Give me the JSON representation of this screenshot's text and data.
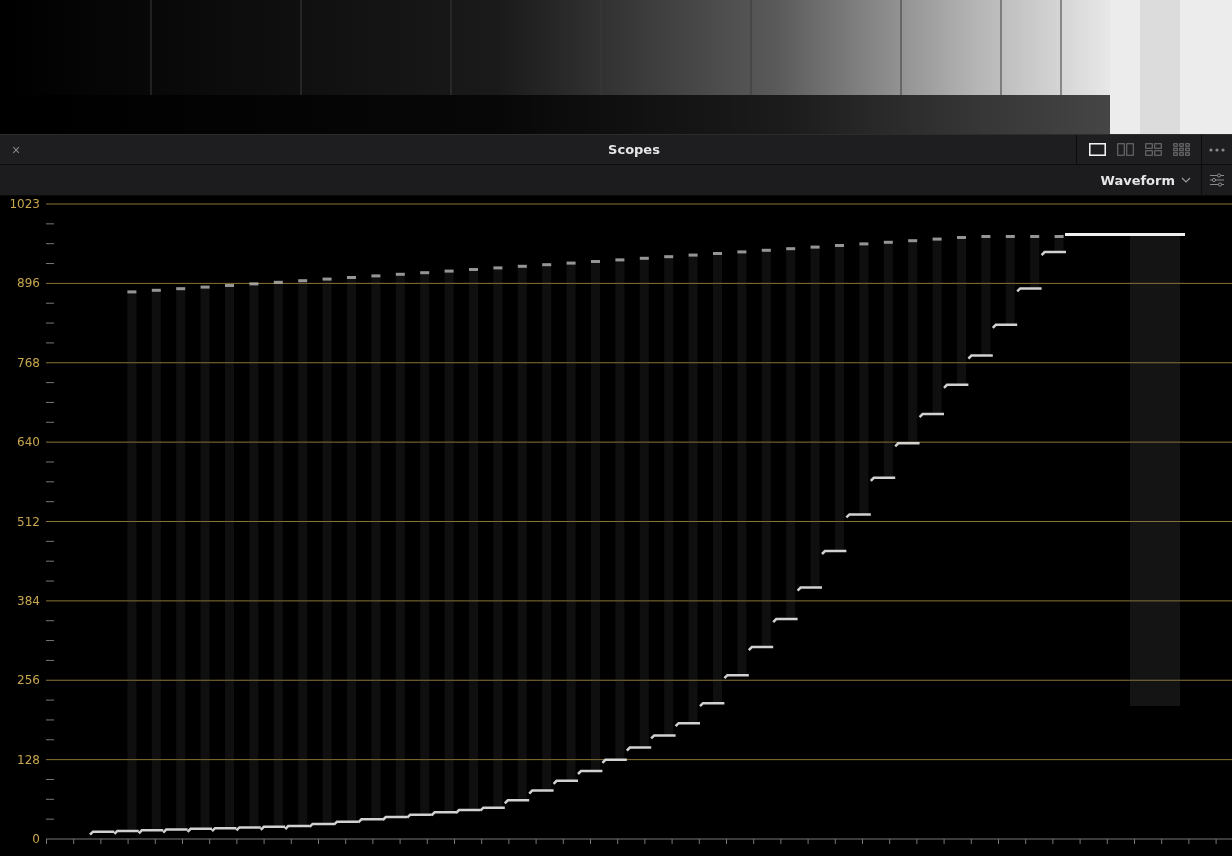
{
  "header": {
    "title": "Scopes",
    "close": "×",
    "layouts": [
      {
        "selected": true
      },
      {
        "selected": false
      },
      {
        "selected": false
      },
      {
        "selected": false
      }
    ]
  },
  "toolbar": {
    "scope_type": "Waveform"
  },
  "scope": {
    "scale": [
      "1023",
      "896",
      "768",
      "640",
      "512",
      "384",
      "256",
      "128",
      "0"
    ]
  }
}
